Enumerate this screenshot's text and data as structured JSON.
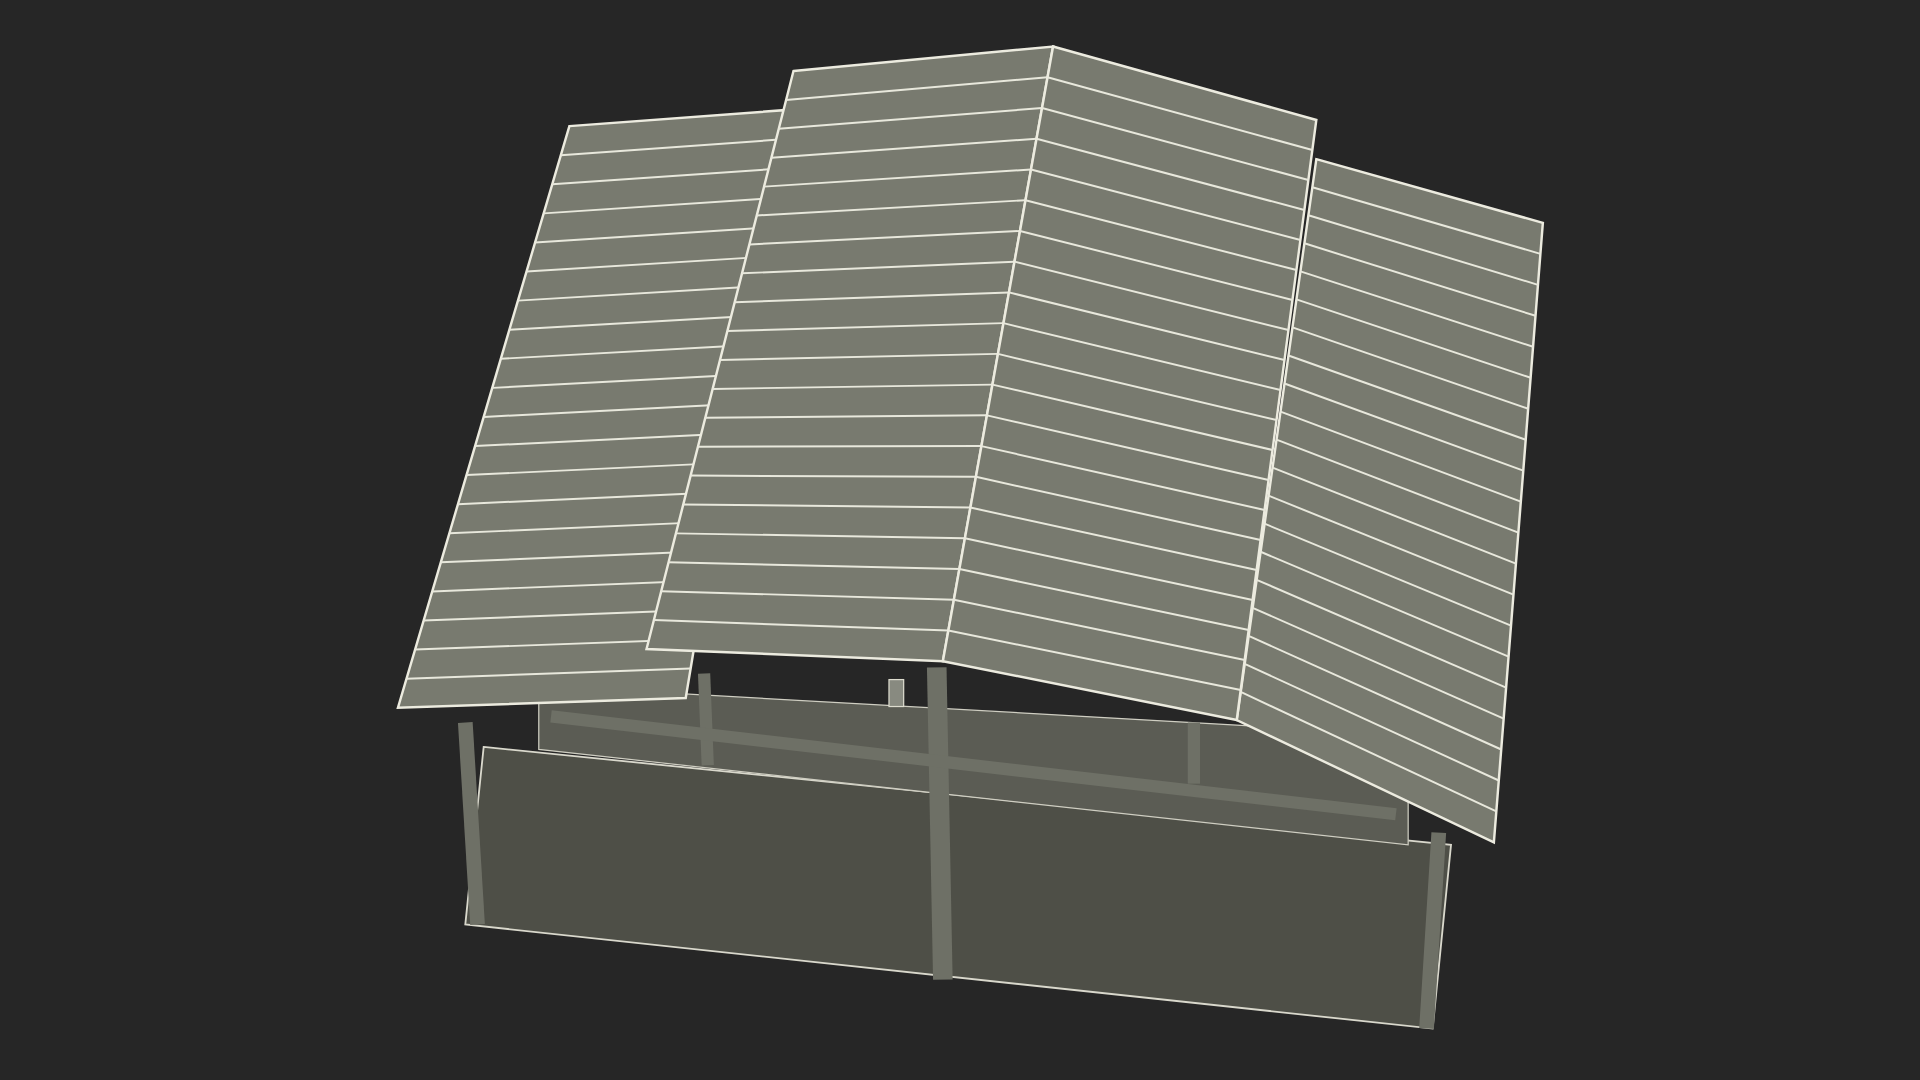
{
  "viewport": {
    "kind": "wireframe-render"
  }
}
